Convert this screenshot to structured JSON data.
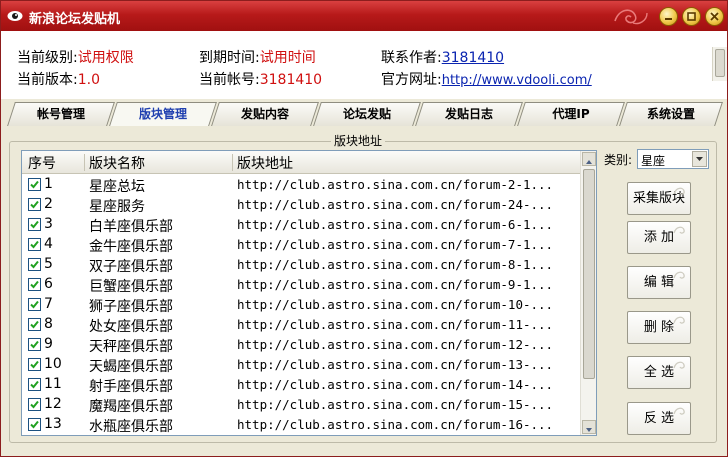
{
  "window": {
    "title": "新浪论坛发贴机"
  },
  "info": {
    "level_label": "当前级别:",
    "level_value": "试用权限",
    "version_label": "当前版本:",
    "version_value": "1.0",
    "expire_label": "到期时间:",
    "expire_value": "试用时间",
    "account_label": "当前帐号:",
    "account_value": "3181410",
    "contact_label": "联系作者:",
    "contact_value": "3181410",
    "site_label": "官方网址:",
    "site_value": "http://www.vdooli.com/"
  },
  "tabs": [
    {
      "label": "帐号管理",
      "active": false
    },
    {
      "label": "版块管理",
      "active": true
    },
    {
      "label": "发贴内容",
      "active": false
    },
    {
      "label": "论坛发贴",
      "active": false
    },
    {
      "label": "发贴日志",
      "active": false
    },
    {
      "label": "代理IP",
      "active": false
    },
    {
      "label": "系统设置",
      "active": false
    }
  ],
  "group": {
    "title": "版块地址"
  },
  "table": {
    "columns": [
      "序号",
      "版块名称",
      "版块地址"
    ],
    "rows": [
      {
        "id": "1",
        "name": "星座总坛",
        "url": "http://club.astro.sina.com.cn/forum-2-1...",
        "checked": true
      },
      {
        "id": "2",
        "name": "星座服务",
        "url": "http://club.astro.sina.com.cn/forum-24-...",
        "checked": true
      },
      {
        "id": "3",
        "name": "白羊座俱乐部",
        "url": "http://club.astro.sina.com.cn/forum-6-1...",
        "checked": true
      },
      {
        "id": "4",
        "name": "金牛座俱乐部",
        "url": "http://club.astro.sina.com.cn/forum-7-1...",
        "checked": true
      },
      {
        "id": "5",
        "name": "双子座俱乐部",
        "url": "http://club.astro.sina.com.cn/forum-8-1...",
        "checked": true
      },
      {
        "id": "6",
        "name": "巨蟹座俱乐部",
        "url": "http://club.astro.sina.com.cn/forum-9-1...",
        "checked": true
      },
      {
        "id": "7",
        "name": "狮子座俱乐部",
        "url": "http://club.astro.sina.com.cn/forum-10-...",
        "checked": true
      },
      {
        "id": "8",
        "name": "处女座俱乐部",
        "url": "http://club.astro.sina.com.cn/forum-11-...",
        "checked": true
      },
      {
        "id": "9",
        "name": "天秤座俱乐部",
        "url": "http://club.astro.sina.com.cn/forum-12-...",
        "checked": true
      },
      {
        "id": "10",
        "name": "天蝎座俱乐部",
        "url": "http://club.astro.sina.com.cn/forum-13-...",
        "checked": true
      },
      {
        "id": "11",
        "name": "射手座俱乐部",
        "url": "http://club.astro.sina.com.cn/forum-14-...",
        "checked": true
      },
      {
        "id": "12",
        "name": "魔羯座俱乐部",
        "url": "http://club.astro.sina.com.cn/forum-15-...",
        "checked": true
      },
      {
        "id": "13",
        "name": "水瓶座俱乐部",
        "url": "http://club.astro.sina.com.cn/forum-16-...",
        "checked": true
      }
    ]
  },
  "category": {
    "label": "类别:",
    "value": "星座"
  },
  "buttons": {
    "collect": "采集版块",
    "add": "添 加",
    "edit": "编 辑",
    "delete": "删 除",
    "select_all": "全 选",
    "invert": "反 选"
  },
  "colors": {
    "title_red": "#b71a1a",
    "accent_red": "#d01010",
    "link_blue": "#0a24b0"
  }
}
